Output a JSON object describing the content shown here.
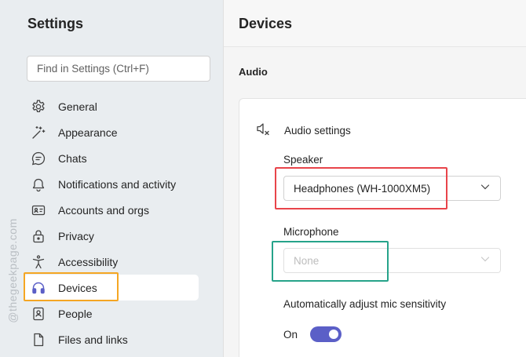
{
  "sidebar": {
    "title": "Settings",
    "search": {
      "placeholder": "Find in Settings (Ctrl+F)",
      "value": ""
    },
    "items": [
      {
        "label": "General",
        "icon": "gear-icon"
      },
      {
        "label": "Appearance",
        "icon": "magic-wand-icon"
      },
      {
        "label": "Chats",
        "icon": "chat-icon"
      },
      {
        "label": "Notifications and activity",
        "icon": "bell-icon"
      },
      {
        "label": "Accounts and orgs",
        "icon": "contact-card-icon"
      },
      {
        "label": "Privacy",
        "icon": "lock-icon"
      },
      {
        "label": "Accessibility",
        "icon": "accessibility-icon"
      },
      {
        "label": "Devices",
        "icon": "headset-icon",
        "active": true
      },
      {
        "label": "People",
        "icon": "contact-book-icon"
      },
      {
        "label": "Files and links",
        "icon": "file-icon"
      }
    ]
  },
  "watermark": "@thegeekpage.com",
  "main": {
    "title": "Devices",
    "section": "Audio",
    "audio_settings": {
      "title": "Audio settings",
      "speaker_label": "Speaker",
      "speaker_value": "Headphones (WH-1000XM5)",
      "microphone_label": "Microphone",
      "microphone_value": "None",
      "auto_adjust_label": "Automatically adjust mic sensitivity",
      "toggle_label": "On",
      "toggle_on": true
    }
  },
  "colors": {
    "accent": "#5b5fc7",
    "highlight_devices": "#f5a623",
    "highlight_speaker": "#e8444a",
    "highlight_microphone": "#26a38a"
  }
}
